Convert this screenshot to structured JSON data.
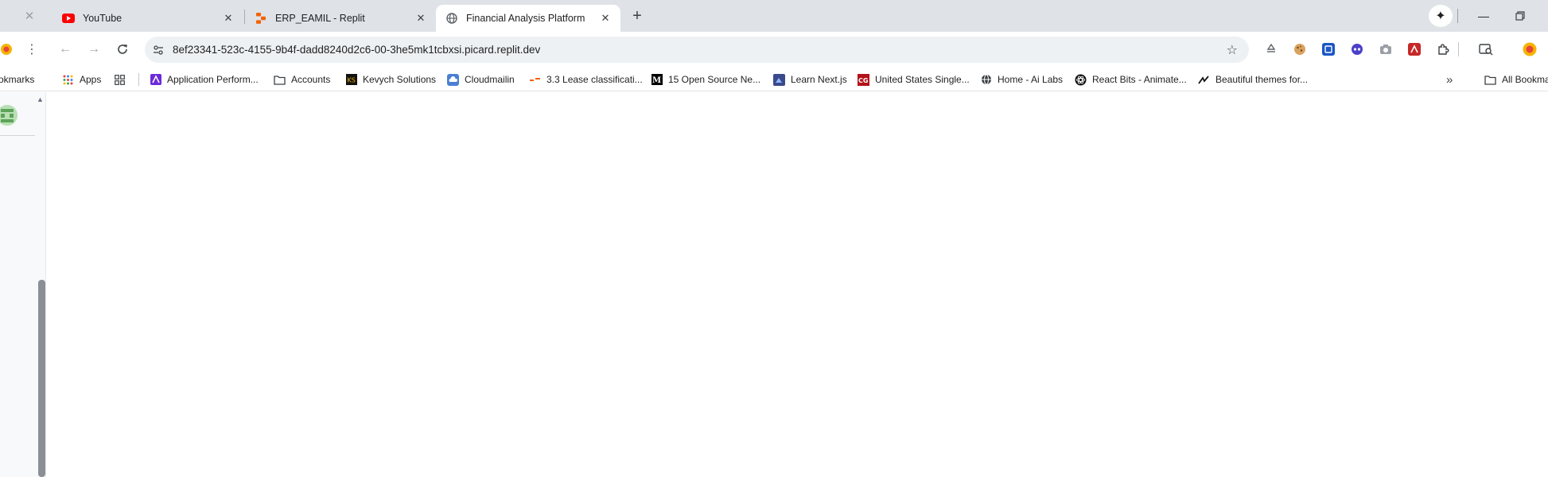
{
  "tabs": [
    {
      "title": "YouTube",
      "favicon": "youtube-icon",
      "active": false
    },
    {
      "title": "ERP_EAMIL - Replit",
      "favicon": "replit-icon",
      "active": false
    },
    {
      "title": "Financial Analysis Platform",
      "favicon": "globe-icon",
      "active": true
    }
  ],
  "address_bar": {
    "url": "8ef23341-523c-4155-9b4f-dadd8240d2c6-00-3he5mk1tcbxsi.picard.replit.dev"
  },
  "bookmarks": {
    "partial_left_label": "okmarks",
    "items": [
      {
        "label": "Apps",
        "icon": "apps-grid-icon"
      },
      {
        "label": "",
        "icon": "tab-groups-icon"
      },
      {
        "label": "Application Perform...",
        "icon": "bookmark-favicon"
      },
      {
        "label": "Accounts",
        "icon": "folder-icon"
      },
      {
        "label": "Kevych Solutions",
        "icon": "ks-icon"
      },
      {
        "label": "Cloudmailin",
        "icon": "cloud-icon"
      },
      {
        "label": "3.3 Lease classificati...",
        "icon": "dash-icon"
      },
      {
        "label": "15 Open Source Ne...",
        "icon": "medium-icon"
      },
      {
        "label": "Learn Next.js",
        "icon": "nextjs-icon"
      },
      {
        "label": "United States Single...",
        "icon": "cg-icon"
      },
      {
        "label": "Home - Ai Labs",
        "icon": "globe-icon"
      },
      {
        "label": "React Bits - Animate...",
        "icon": "react-icon"
      },
      {
        "label": "Beautiful themes for...",
        "icon": "themes-icon"
      }
    ],
    "overflow_label": "»",
    "all_bookmarks_label": "All Bookma"
  },
  "colors": {
    "tabstrip_bg": "#dfe3e8",
    "omnibox_bg": "#eef1f4",
    "youtube_red": "#ff0000",
    "replit_orange": "#f26207"
  }
}
